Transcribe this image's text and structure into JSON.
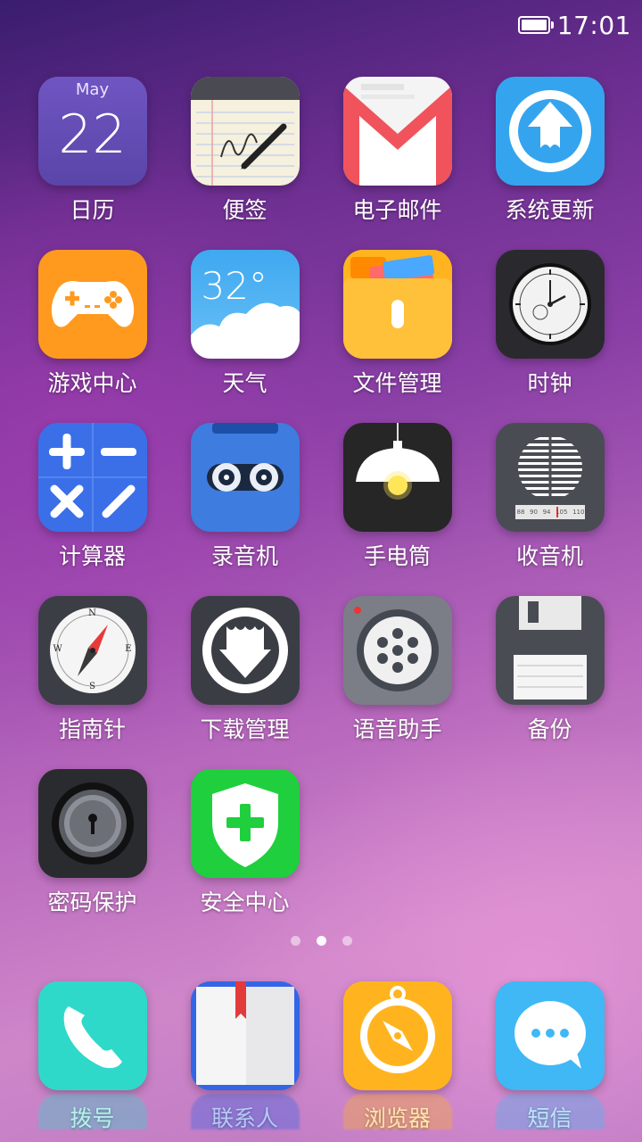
{
  "status": {
    "time": "17:01"
  },
  "calendar": {
    "month": "May",
    "day": "22"
  },
  "weather": {
    "temp": "32°"
  },
  "apps": [
    {
      "label": "日历"
    },
    {
      "label": "便签"
    },
    {
      "label": "电子邮件"
    },
    {
      "label": "系统更新"
    },
    {
      "label": "游戏中心"
    },
    {
      "label": "天气"
    },
    {
      "label": "文件管理"
    },
    {
      "label": "时钟"
    },
    {
      "label": "计算器"
    },
    {
      "label": "录音机"
    },
    {
      "label": "手电筒"
    },
    {
      "label": "收音机"
    },
    {
      "label": "指南针"
    },
    {
      "label": "下载管理"
    },
    {
      "label": "语音助手"
    },
    {
      "label": "备份"
    },
    {
      "label": "密码保护"
    },
    {
      "label": "安全中心"
    }
  ],
  "compass": {
    "n": "N",
    "s": "S",
    "e": "E",
    "w": "W"
  },
  "radio_ticks": [
    "88",
    "90",
    "94",
    "105",
    "110"
  ],
  "dock": [
    {
      "label": "拨号"
    },
    {
      "label": "联系人"
    },
    {
      "label": "浏览器"
    },
    {
      "label": "短信"
    }
  ],
  "colors": {
    "accent_pink": "#cf86c9",
    "deep_purple": "#3a1d6e"
  }
}
